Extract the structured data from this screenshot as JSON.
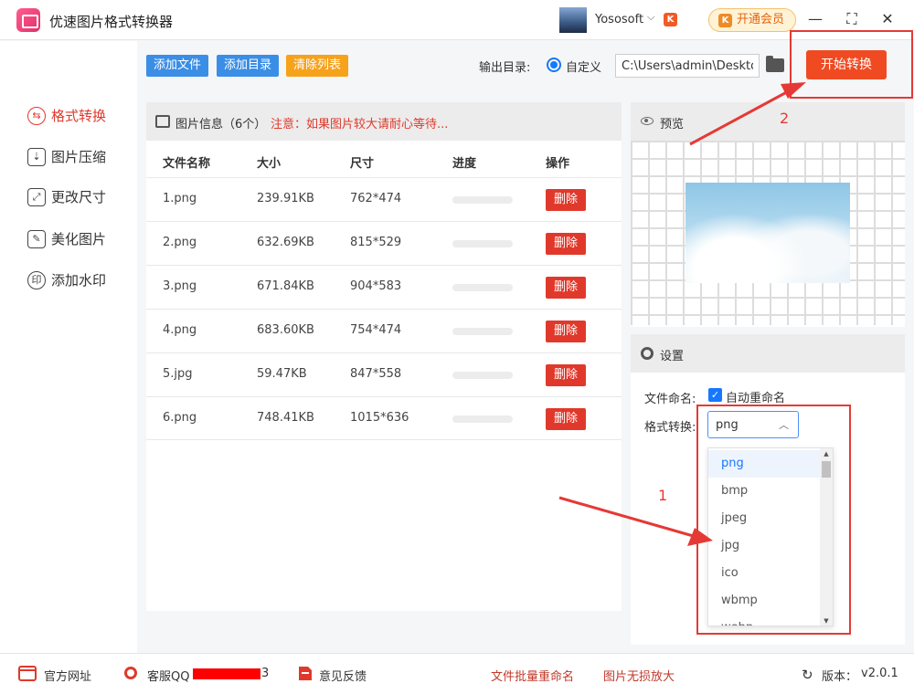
{
  "app": {
    "title": "优速图片格式转换器",
    "user": "Yososoft",
    "vip_label": "开通会员",
    "brand_badge": "K"
  },
  "window": {
    "minimize": "—",
    "maximize": "⛶",
    "close": "✕"
  },
  "sidebar": {
    "items": [
      {
        "label": "格式转换",
        "icon": "format-convert-icon",
        "active": true
      },
      {
        "label": "图片压缩",
        "icon": "compress-icon"
      },
      {
        "label": "更改尺寸",
        "icon": "resize-icon"
      },
      {
        "label": "美化图片",
        "icon": "beautify-icon"
      },
      {
        "label": "添加水印",
        "icon": "watermark-icon"
      }
    ]
  },
  "toolbar": {
    "add_file": "添加文件",
    "add_dir": "添加目录",
    "clear_list": "清除列表",
    "output_label": "输出目录:",
    "custom_label": "自定义",
    "output_path": "C:\\Users\\admin\\Deskto",
    "start_label": "开始转换",
    "colors": {
      "add": "#3a8ee6",
      "clear": "#f7a21b",
      "start": "#ef4a22"
    }
  },
  "file_panel": {
    "title": "图片信息（6个）",
    "warning": "注意：如果图片较大请耐心等待...",
    "columns": [
      "文件名称",
      "大小",
      "尺寸",
      "进度",
      "操作"
    ],
    "delete_label": "删除",
    "rows": [
      {
        "name": "1.png",
        "size": "239.91KB",
        "dims": "762*474",
        "progress": 0
      },
      {
        "name": "2.png",
        "size": "632.69KB",
        "dims": "815*529",
        "progress": 0
      },
      {
        "name": "3.png",
        "size": "671.84KB",
        "dims": "904*583",
        "progress": 0
      },
      {
        "name": "4.png",
        "size": "683.60KB",
        "dims": "754*474",
        "progress": 0
      },
      {
        "name": "5.jpg",
        "size": "59.47KB",
        "dims": "847*558",
        "progress": 0
      },
      {
        "name": "6.png",
        "size": "748.41KB",
        "dims": "1015*636",
        "progress": 0
      }
    ]
  },
  "preview": {
    "title": "预览"
  },
  "settings": {
    "title": "设置",
    "naming_label": "文件命名:",
    "auto_rename_label": "自动重命名",
    "auto_rename_checked": true,
    "format_label": "格式转换:",
    "format_value": "png",
    "format_options": [
      "png",
      "bmp",
      "jpeg",
      "jpg",
      "ico",
      "wbmp",
      "webp"
    ]
  },
  "annotations": {
    "step1": "1",
    "step2": "2",
    "color": "#e53935"
  },
  "footer": {
    "website": "官方网址",
    "qq": "客服QQ",
    "qq_tail": "3",
    "feedback": "意见反馈",
    "batch_rename": "文件批量重命名",
    "enlarge": "图片无损放大",
    "version_label": "版本：",
    "version": "v2.0.1"
  }
}
